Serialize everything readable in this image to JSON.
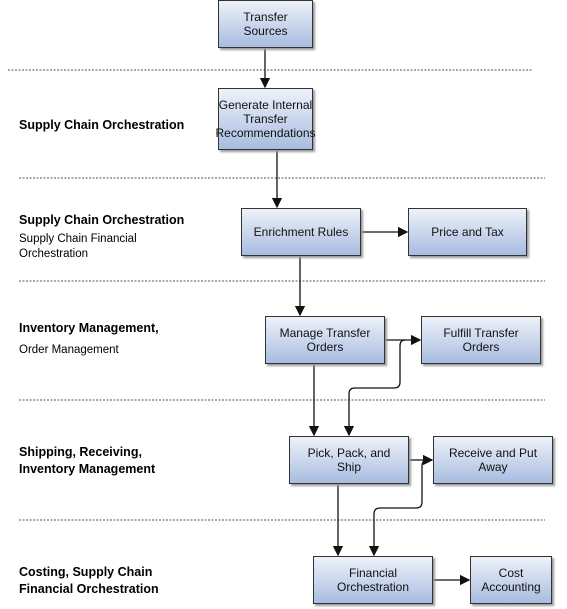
{
  "boxes": {
    "transfer_sources": "Transfer Sources",
    "generate": "Generate Internal Transfer Recommendations",
    "enrichment": "Enrichment Rules",
    "price_tax": "Price and Tax",
    "manage": "Manage Transfer Orders",
    "fulfill": "Fulfill Transfer Orders",
    "pick": "Pick, Pack, and Ship",
    "receive": "Receive and Put Away",
    "financial": "Financial Orchestration",
    "cost": "Cost Accounting"
  },
  "lanes": [
    {
      "title": "Supply Chain Orchestration"
    },
    {
      "title": "Supply Chain Orchestration",
      "sub": "Supply Chain Financial Orchestration"
    },
    {
      "title": "Inventory Management,",
      "sub": "Order Management"
    },
    {
      "title": "Shipping, Receiving, Inventory Management"
    },
    {
      "title": "Costing, Supply Chain Financial Orchestration"
    }
  ]
}
